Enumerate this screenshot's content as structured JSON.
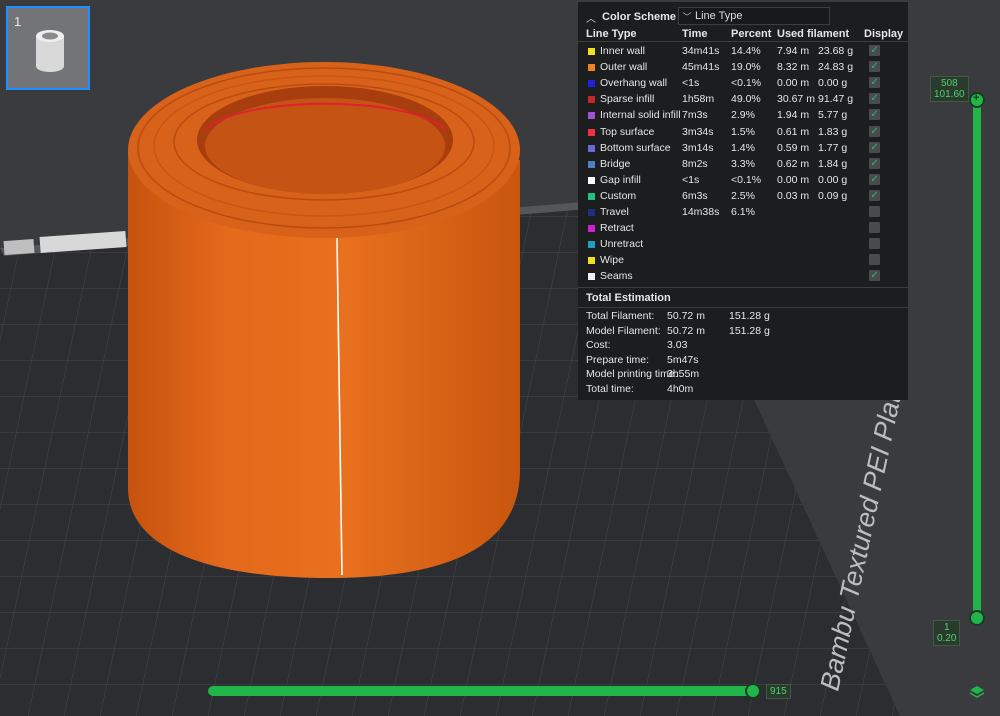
{
  "plate": {
    "number": "1",
    "label": "Bambu Textured PEI Plate"
  },
  "color_scheme": {
    "title": "Color Scheme",
    "selected": "Line Type"
  },
  "columns": [
    "Line Type",
    "Time",
    "Percent",
    "Used filament",
    "Display"
  ],
  "rows": [
    {
      "name": "Inner wall",
      "time": "34m41s",
      "percent": "14.4%",
      "length": "7.94 m",
      "weight": "23.68 g",
      "color": "#f0e020",
      "display": true
    },
    {
      "name": "Outer wall",
      "time": "45m41s",
      "percent": "19.0%",
      "length": "8.32 m",
      "weight": "24.83 g",
      "color": "#f08020",
      "display": true
    },
    {
      "name": "Overhang wall",
      "time": "<1s",
      "percent": "<0.1%",
      "length": "0.00 m",
      "weight": "0.00 g",
      "color": "#2020e0",
      "display": true
    },
    {
      "name": "Sparse infill",
      "time": "1h58m",
      "percent": "49.0%",
      "length": "30.67 m",
      "weight": "91.47 g",
      "color": "#c02828",
      "display": true
    },
    {
      "name": "Internal solid infill",
      "time": "7m3s",
      "percent": "2.9%",
      "length": "1.94 m",
      "weight": "5.77 g",
      "color": "#a050d0",
      "display": true
    },
    {
      "name": "Top surface",
      "time": "3m34s",
      "percent": "1.5%",
      "length": "0.61 m",
      "weight": "1.83 g",
      "color": "#f03040",
      "display": true
    },
    {
      "name": "Bottom surface",
      "time": "3m14s",
      "percent": "1.4%",
      "length": "0.59 m",
      "weight": "1.77 g",
      "color": "#6a6ad0",
      "display": true
    },
    {
      "name": "Bridge",
      "time": "8m2s",
      "percent": "3.3%",
      "length": "0.62 m",
      "weight": "1.84 g",
      "color": "#5080c0",
      "display": true
    },
    {
      "name": "Gap infill",
      "time": "<1s",
      "percent": "<0.1%",
      "length": "0.00 m",
      "weight": "0.00 g",
      "color": "#ffffff",
      "display": true
    },
    {
      "name": "Custom",
      "time": "6m3s",
      "percent": "2.5%",
      "length": "0.03 m",
      "weight": "0.09 g",
      "color": "#20c080",
      "display": true
    },
    {
      "name": "Travel",
      "time": "14m38s",
      "percent": "6.1%",
      "length": "",
      "weight": "",
      "color": "#203080",
      "display": false
    },
    {
      "name": "Retract",
      "time": "",
      "percent": "",
      "length": "",
      "weight": "",
      "color": "#d020d0",
      "display": false
    },
    {
      "name": "Unretract",
      "time": "",
      "percent": "",
      "length": "",
      "weight": "",
      "color": "#20a0c0",
      "display": false
    },
    {
      "name": "Wipe",
      "time": "",
      "percent": "",
      "length": "",
      "weight": "",
      "color": "#f0e020",
      "display": false
    },
    {
      "name": "Seams",
      "time": "",
      "percent": "",
      "length": "",
      "weight": "",
      "color": "#f0f0f0",
      "display": true
    }
  ],
  "estimation": {
    "title": "Total Estimation",
    "items": [
      {
        "label": "Total Filament:",
        "v1": "50.72 m",
        "v2": "151.28 g"
      },
      {
        "label": "Model Filament:",
        "v1": "50.72 m",
        "v2": "151.28 g"
      },
      {
        "label": "Cost:",
        "v1": "3.03",
        "v2": ""
      },
      {
        "label": "Prepare time:",
        "v1": "5m47s",
        "v2": ""
      },
      {
        "label": "Model printing time:",
        "v1": "3h55m",
        "v2": ""
      },
      {
        "label": "Total time:",
        "v1": "4h0m",
        "v2": ""
      }
    ]
  },
  "layer_slider": {
    "top_layer": "508",
    "top_height": "101.60",
    "bottom_layer": "1",
    "bottom_height": "0.20"
  },
  "move_slider": {
    "value": "915"
  },
  "colors": {
    "accent": "#21b64a",
    "model": "#e06a1a"
  }
}
